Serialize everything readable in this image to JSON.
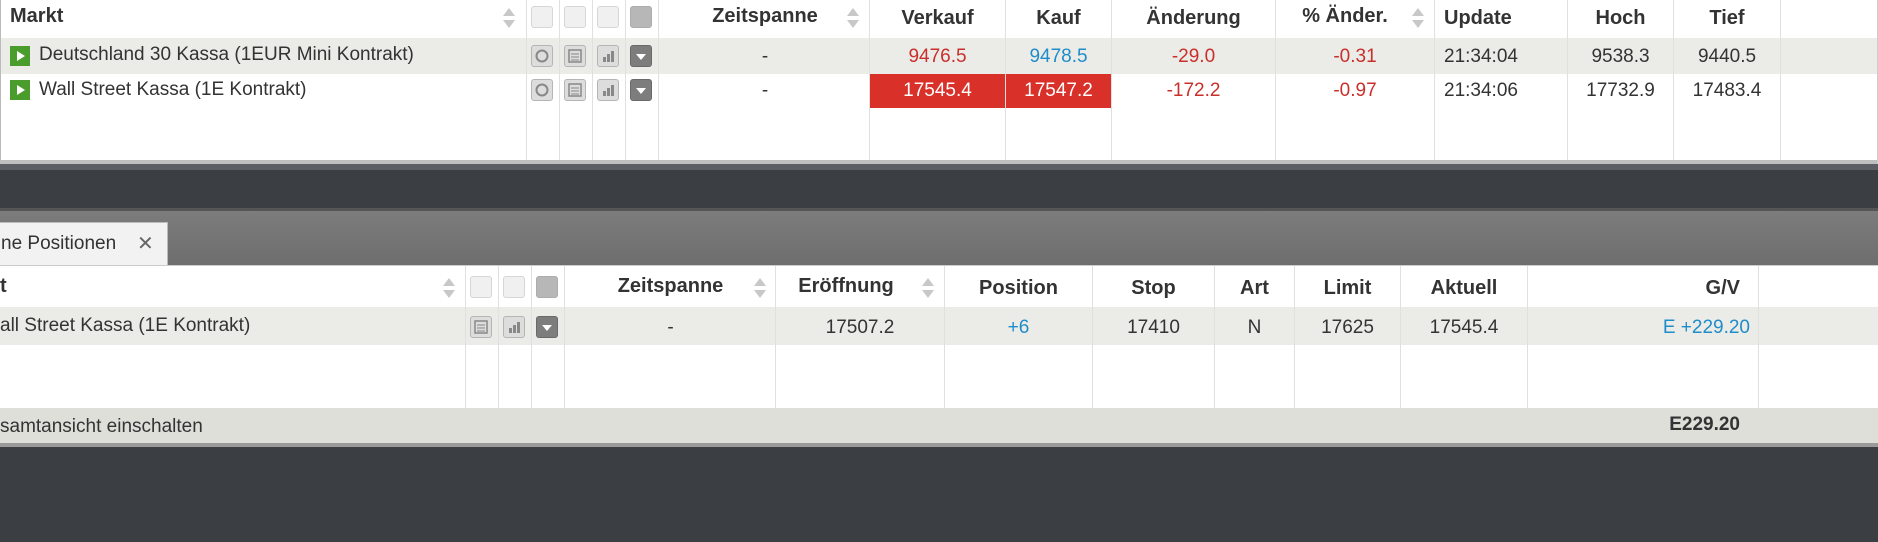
{
  "markets": {
    "headers": {
      "markt": "Markt",
      "zeitspanne": "Zeitspanne",
      "verkauf": "Verkauf",
      "kauf": "Kauf",
      "aenderung": "Änderung",
      "pct": "% Änder.",
      "update": "Update",
      "hoch": "Hoch",
      "tief": "Tief"
    },
    "rows": [
      {
        "name": "Deutschland 30 Kassa (1EUR Mini Kontrakt)",
        "zeitspanne": "-",
        "verkauf": "9476.5",
        "kauf": "9478.5",
        "aenderung": "-29.0",
        "pct": "-0.31",
        "update": "21:34:04",
        "hoch": "9538.3",
        "tief": "9440.5"
      },
      {
        "name": "Wall Street Kassa (1E Kontrakt)",
        "zeitspanne": "-",
        "verkauf": "17545.4",
        "kauf": "17547.2",
        "aenderung": "-172.2",
        "pct": "-0.97",
        "update": "21:34:06",
        "hoch": "17732.9",
        "tief": "17483.4"
      }
    ]
  },
  "tab": {
    "label": "ne Positionen",
    "close": "✕"
  },
  "positions": {
    "headers": {
      "markt": "t",
      "zeitspanne": "Zeitspanne",
      "eroeffnung": "Eröffnung",
      "position": "Position",
      "stop": "Stop",
      "art": "Art",
      "limit": "Limit",
      "aktuell": "Aktuell",
      "gv": "G/V"
    },
    "rows": [
      {
        "name": "all Street Kassa (1E Kontrakt)",
        "zeitspanne": "-",
        "eroeffnung": "17507.2",
        "position": "+6",
        "stop": "17410",
        "art": "N",
        "limit": "17625",
        "aktuell": "17545.4",
        "gv": "E +229.20"
      }
    ],
    "footer": {
      "toggle": "samtansicht einschalten",
      "total": "E229.20"
    }
  },
  "colors": {
    "red": "#c9302c",
    "blue": "#1f8dc9",
    "red_cell": "#d9302a",
    "green_play": "#4a9d2c"
  }
}
